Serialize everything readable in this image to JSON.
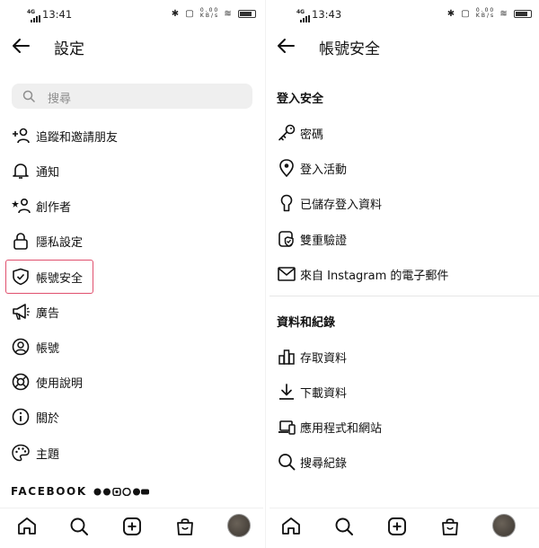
{
  "left": {
    "status": {
      "time": "13:41",
      "network": "4G"
    },
    "title": "設定",
    "search_placeholder": "搜尋",
    "items": [
      {
        "label": "追蹤和邀請朋友",
        "icon": "add-person-icon"
      },
      {
        "label": "通知",
        "icon": "bell-icon"
      },
      {
        "label": "創作者",
        "icon": "star-person-icon"
      },
      {
        "label": "隱私設定",
        "icon": "lock-icon"
      },
      {
        "label": "帳號安全",
        "icon": "shield-icon"
      },
      {
        "label": "廣告",
        "icon": "megaphone-icon"
      },
      {
        "label": "帳號",
        "icon": "account-circle-icon"
      },
      {
        "label": "使用說明",
        "icon": "lifebuoy-icon"
      },
      {
        "label": "關於",
        "icon": "info-icon"
      },
      {
        "label": "主題",
        "icon": "palette-icon"
      }
    ],
    "footer_brand": "FACEBOOK"
  },
  "right": {
    "status": {
      "time": "13:43",
      "network": "4G"
    },
    "title": "帳號安全",
    "section1_title": "登入安全",
    "section1_items": [
      {
        "label": "密碼",
        "icon": "key-icon"
      },
      {
        "label": "登入活動",
        "icon": "location-pin-icon"
      },
      {
        "label": "已儲存登入資料",
        "icon": "keyhole-icon"
      },
      {
        "label": "雙重驗證",
        "icon": "shield-check-icon"
      },
      {
        "label": "來自 Instagram 的電子郵件",
        "icon": "envelope-icon"
      }
    ],
    "section2_title": "資料和紀錄",
    "section2_items": [
      {
        "label": "存取資料",
        "icon": "bar-chart-icon"
      },
      {
        "label": "下載資料",
        "icon": "download-icon"
      },
      {
        "label": "應用程式和網站",
        "icon": "devices-icon"
      },
      {
        "label": "搜尋紀錄",
        "icon": "search-icon"
      }
    ]
  },
  "colors": {
    "highlight": "#e0506e",
    "search_bg": "#efefef"
  }
}
